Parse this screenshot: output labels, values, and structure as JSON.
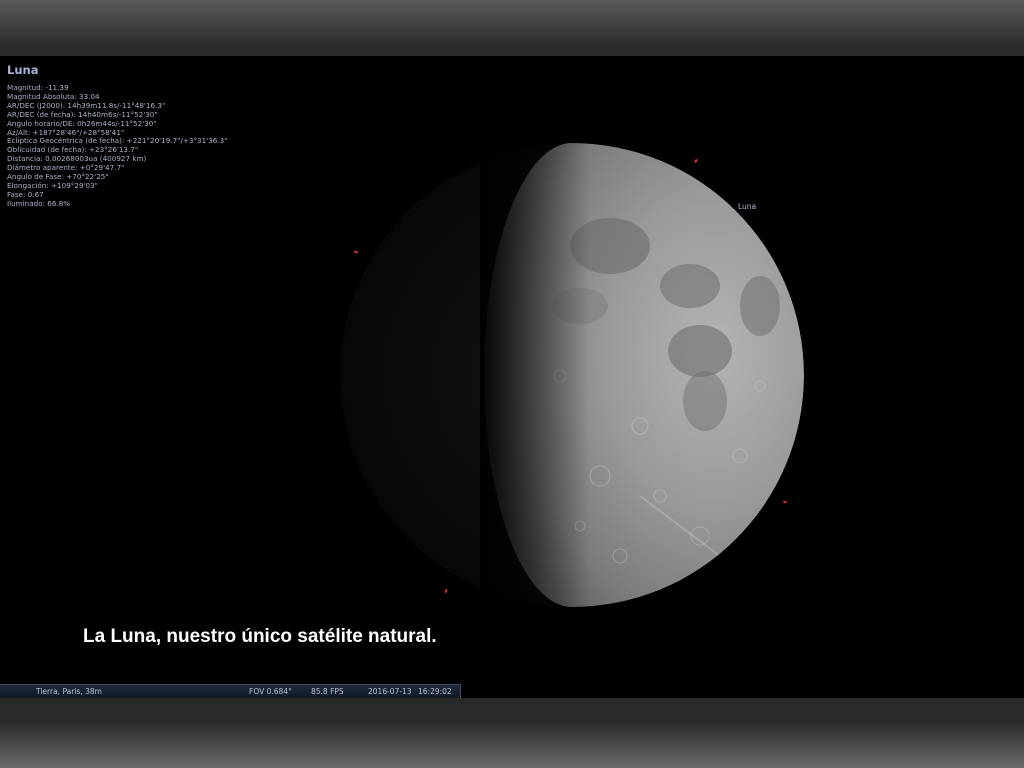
{
  "object_info": {
    "title": "Luna",
    "lines": [
      "Magnitud: -11.39",
      "Magnitud Absoluta: 33.04",
      "AR/DEC (J2000): 14h39m11.8s/-11°48'16.3\"",
      "AR/DEC (de fecha): 14h40m6s/-11°52'30\"",
      "Angulo horario/DE: 0h26m44s/-11°52'30\"",
      "Az/Alt: +187°28'46\"/+28°58'41\"",
      "Ecliptica Geocéntrica (de fecha): +221°20'19.7\"/+3°31'36.3\"",
      "Oblicuidad (de fecha): +23°26'13.7\"",
      "Distancia: 0.00268003ua (400927 km)",
      "Diámetro aparente: +0°29'47.7\"",
      "Angulo de Fase: +70°22'25\"",
      "Elongación: +109°29'03\"",
      "Fase: 0.67",
      "Iluminado: 66.8%"
    ]
  },
  "sky_label": "Luna",
  "caption": "La Luna, nuestro único satélite natural.",
  "status_bar": {
    "location": "Tierra, Paris, 38m",
    "fov": "FOV 0.684°",
    "fps": "85.8 FPS",
    "date": "2016-07-13",
    "time": "16:29:02"
  },
  "colors": {
    "info_text": "#a9b3c9",
    "marker": "#d8322a",
    "caption": "#ffffff"
  }
}
